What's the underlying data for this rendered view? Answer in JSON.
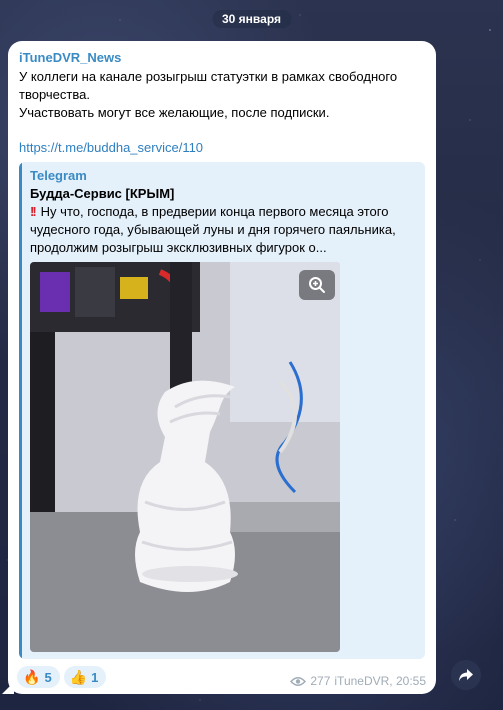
{
  "date_label": "30 января",
  "post": {
    "channel_name": "iTuneDVR_News",
    "text_line_1": "У коллеги на канале розыгрыш статуэтки в рамках свободного творчества.",
    "text_line_2": "Участвовать могут все желающие, после подписки.",
    "link": "https://t.me/buddha_service/110"
  },
  "preview": {
    "site_name": "Telegram",
    "title": "Будда-Сервис [КРЫМ]",
    "exclamation": "!!",
    "description": "Ну что, господа, в предверии конца первого месяца этого чудесного года, убывающей луны и дня горячего паяльника, продолжим розыгрыш эксклюзивных фигурок о..."
  },
  "reactions": [
    {
      "emoji": "🔥",
      "count": "5"
    },
    {
      "emoji": "👍",
      "count": "1"
    }
  ],
  "meta": {
    "views": "277",
    "author_time": "iTuneDVR, 20:55"
  },
  "icons": {
    "zoom": "zoom-in-icon",
    "views": "eye-icon",
    "share": "share-arrow-icon"
  },
  "colors": {
    "accent": "#3a8bc4",
    "link": "#2f7fbf",
    "preview_bg": "#e4f0fa",
    "exclamation": "#d6202c"
  }
}
